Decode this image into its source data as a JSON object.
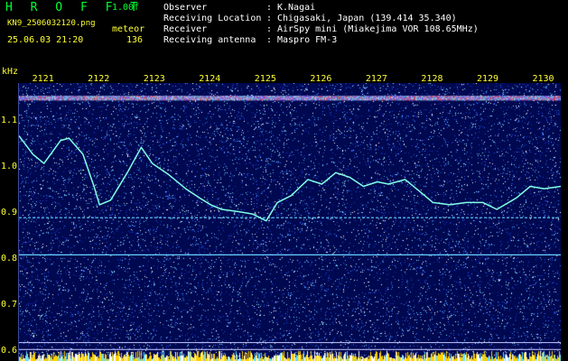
{
  "header": {
    "brand": "H R O F F T",
    "version": "1.00f",
    "filename": "KN9_2506032120.png",
    "mode": "meteor",
    "timestamp": "25.06.03 21:20",
    "count": "136"
  },
  "info": [
    {
      "label": "Observer",
      "sep": ":",
      "value": "K.Nagai"
    },
    {
      "label": "Receiving Location",
      "sep": ":",
      "value": "Chigasaki, Japan (139.414 35.340)"
    },
    {
      "label": "Receiver",
      "sep": ":",
      "value": "AirSpy mini (Miakejima VOR 108.65MHz)"
    },
    {
      "label": "Receiving antenna",
      "sep": ":",
      "value": "Maspro FM-3"
    }
  ],
  "chart_data": {
    "type": "heatmap",
    "ylabel": "kHz",
    "ylim": [
      0.58,
      1.185
    ],
    "xlim": [
      2120.55,
      2130.3
    ],
    "x_ticks": [
      "2121",
      "2122",
      "2123",
      "2124",
      "2125",
      "2126",
      "2127",
      "2128",
      "2129",
      "2130"
    ],
    "y_ticks": [
      "1.1",
      "1.0",
      "0.9",
      "0.8",
      "0.7",
      "0.6"
    ],
    "horizontal_lines_khz": [
      1.153,
      0.892,
      0.811,
      0.62,
      0.605
    ],
    "trace": {
      "x": [
        2120.55,
        2120.8,
        2121.0,
        2121.3,
        2121.45,
        2121.7,
        2121.9,
        2122.0,
        2122.2,
        2122.5,
        2122.75,
        2122.95,
        2123.25,
        2123.55,
        2123.8,
        2124.0,
        2124.2,
        2124.5,
        2124.75,
        2125.0,
        2125.2,
        2125.45,
        2125.75,
        2126.0,
        2126.25,
        2126.5,
        2126.75,
        2127.0,
        2127.2,
        2127.5,
        2127.75,
        2128.0,
        2128.3,
        2128.6,
        2128.9,
        2129.15,
        2129.5,
        2129.75,
        2130.0,
        2130.3
      ],
      "y": [
        1.07,
        1.03,
        1.01,
        1.06,
        1.065,
        1.03,
        0.96,
        0.92,
        0.93,
        0.99,
        1.045,
        1.01,
        0.985,
        0.955,
        0.935,
        0.92,
        0.91,
        0.905,
        0.9,
        0.885,
        0.925,
        0.94,
        0.975,
        0.965,
        0.99,
        0.98,
        0.96,
        0.97,
        0.965,
        0.975,
        0.95,
        0.925,
        0.92,
        0.925,
        0.925,
        0.91,
        0.935,
        0.96,
        0.955,
        0.96
      ]
    },
    "colors": {
      "background": "#000850",
      "trace": "#7fffe6",
      "ticks": "#ffff33",
      "baseline": "#ffd000"
    }
  }
}
